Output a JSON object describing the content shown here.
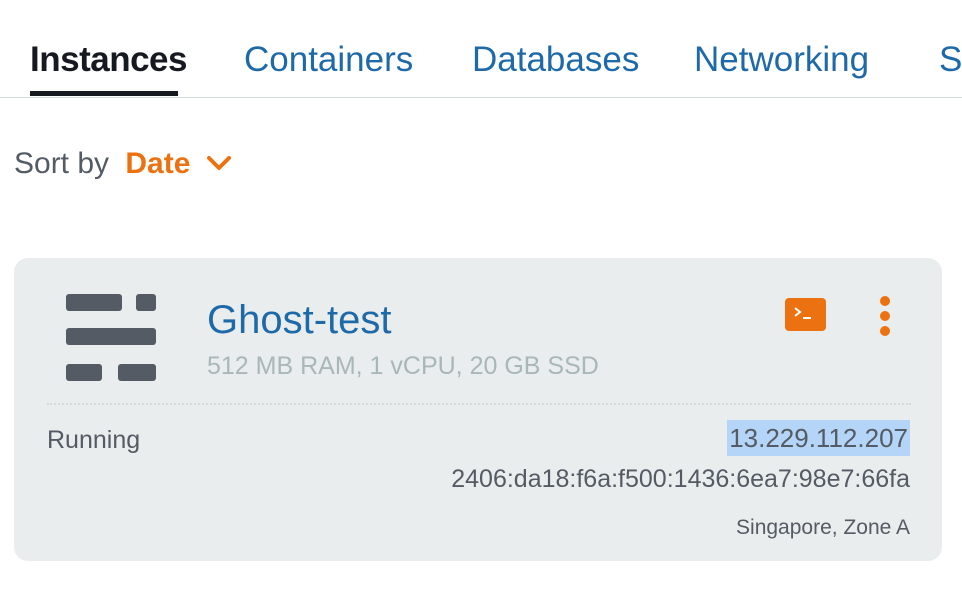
{
  "tabs": [
    {
      "label": "Instances",
      "active": true
    },
    {
      "label": "Containers",
      "active": false
    },
    {
      "label": "Databases",
      "active": false
    },
    {
      "label": "Networking",
      "active": false
    },
    {
      "label": "St",
      "active": false
    }
  ],
  "sort": {
    "prefix": "Sort by",
    "value": "Date",
    "icon": "chevron-down-icon"
  },
  "instance": {
    "name": "Ghost-test",
    "specs": "512 MB RAM, 1 vCPU, 20 GB SSD",
    "status": "Running",
    "ipv4": "13.229.112.207",
    "ipv6": "2406:da18:f6a:f500:1436:6ea7:98e7:66fa",
    "location": "Singapore, Zone A",
    "icons": {
      "server": "server-icon",
      "connect": "terminal-icon",
      "menu": "more-vertical-icon"
    }
  },
  "colors": {
    "accent": "#ec7211",
    "link": "#1e6aa9",
    "text": "#16191f",
    "muted": "#545b64",
    "card_bg": "#eaeded",
    "selection": "#b4d5f7"
  }
}
